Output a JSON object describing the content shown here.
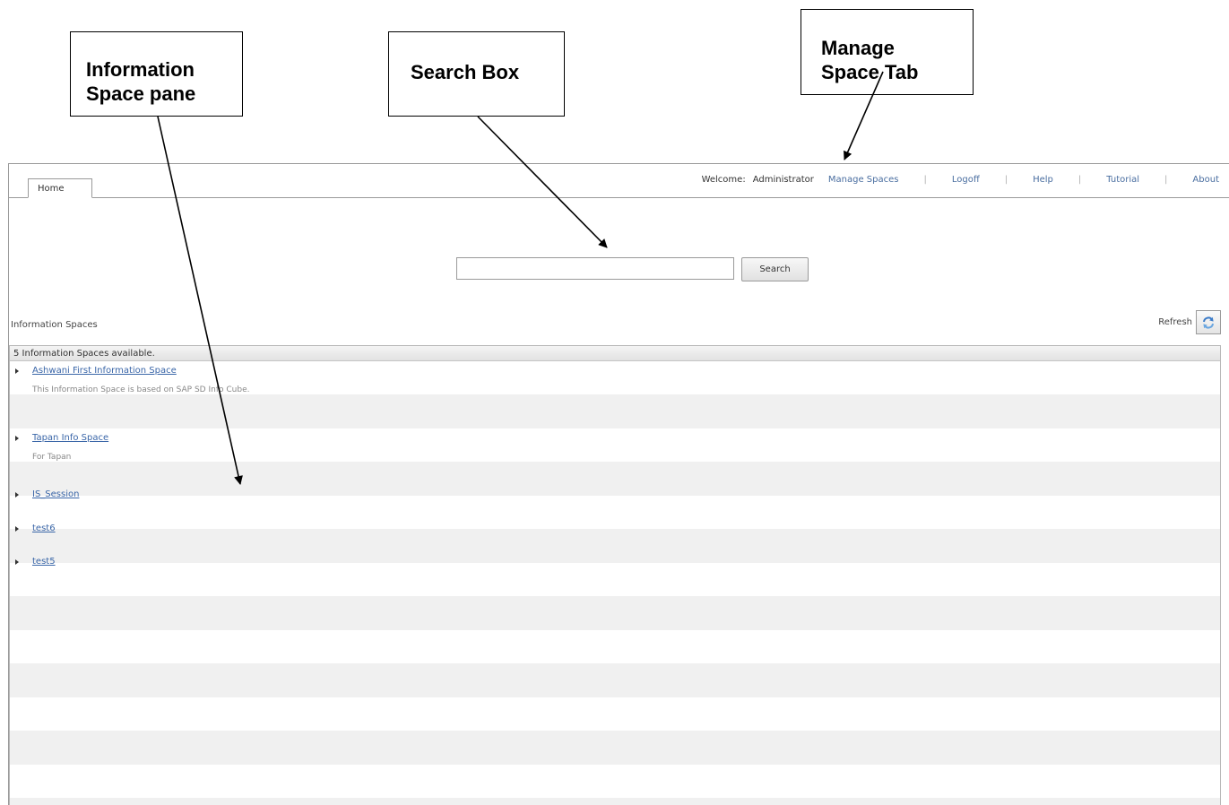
{
  "callouts": {
    "info_line1": "Information",
    "info_line2": "Space pane",
    "search": "Search Box",
    "manage_line1": "Manage",
    "manage_line2": "Space Tab"
  },
  "topnav": {
    "welcome_label": "Welcome:",
    "user": "Administrator",
    "manage_spaces": "Manage Spaces",
    "logoff": "Logoff",
    "help": "Help",
    "tutorial": "Tutorial",
    "about": "About",
    "separator": "|"
  },
  "tabs": {
    "home": "Home"
  },
  "search": {
    "value": "",
    "button": "Search"
  },
  "panel": {
    "title": "Information Spaces",
    "refresh": "Refresh",
    "count_text": "5 Information Spaces available.",
    "items": [
      {
        "title": "Ashwani First Information Space",
        "description": "This Information Space is based on SAP SD Info Cube."
      },
      {
        "title": "Tapan Info Space",
        "description": "For Tapan"
      },
      {
        "title": "IS_Session",
        "description": ""
      },
      {
        "title": "test6",
        "description": ""
      },
      {
        "title": "test5",
        "description": ""
      }
    ]
  }
}
